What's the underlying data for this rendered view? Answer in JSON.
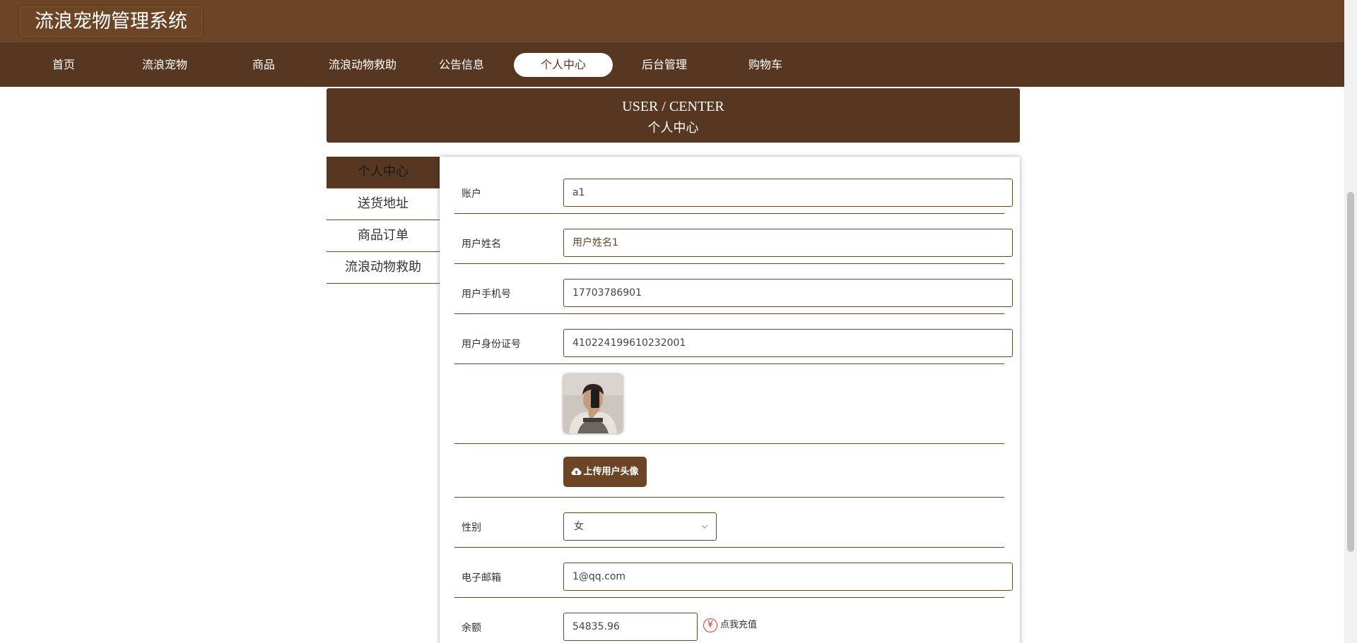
{
  "app": {
    "title": "流浪宠物管理系统"
  },
  "nav": {
    "items": [
      {
        "label": "首页",
        "active": false
      },
      {
        "label": "流浪宠物",
        "active": false
      },
      {
        "label": "商品",
        "active": false
      },
      {
        "label": "流浪动物救助",
        "active": false
      },
      {
        "label": "公告信息",
        "active": false
      },
      {
        "label": "个人中心",
        "active": true
      },
      {
        "label": "后台管理",
        "active": false
      },
      {
        "label": "购物车",
        "active": false
      }
    ]
  },
  "banner": {
    "en": "USER / CENTER",
    "cn": "个人中心"
  },
  "sidemenu": {
    "items": [
      {
        "label": "个人中心",
        "active": true
      },
      {
        "label": "送货地址",
        "active": false
      },
      {
        "label": "商品订单",
        "active": false
      },
      {
        "label": "流浪动物救助",
        "active": false
      }
    ]
  },
  "form": {
    "account": {
      "label": "账户",
      "value": "a1"
    },
    "name": {
      "label": "用户姓名",
      "value": "用户姓名1"
    },
    "phone": {
      "label": "用户手机号",
      "value": "17703786901"
    },
    "idcard": {
      "label": "用户身份证号",
      "value": "410224199610232001"
    },
    "avatar": {
      "icon": "user-photo"
    },
    "upload_button": {
      "label": "上传用户头像",
      "icon": "cloud-upload-icon"
    },
    "gender": {
      "label": "性别",
      "value": "女"
    },
    "email": {
      "label": "电子邮箱",
      "value": "1@qq.com"
    },
    "balance": {
      "label": "余额",
      "value": "54835.96",
      "recharge_label": "点我充值",
      "recharge_icon": "yen-icon"
    }
  },
  "colors": {
    "header": "#6b4526",
    "nav": "#573721",
    "accent": "#6b4526",
    "danger": "#e53935"
  }
}
